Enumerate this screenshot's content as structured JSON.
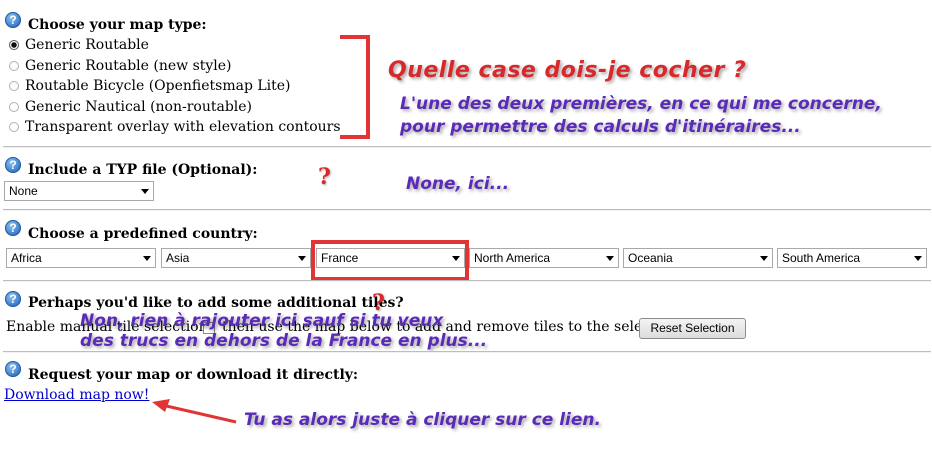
{
  "sections": {
    "map_type": {
      "heading": "Choose your map type:",
      "options": [
        {
          "label": "Generic Routable",
          "checked": true
        },
        {
          "label": "Generic Routable (new style)",
          "checked": false
        },
        {
          "label": "Routable Bicycle (Openfietsmap Lite)",
          "checked": false
        },
        {
          "label": "Generic Nautical (non-routable)",
          "checked": false
        },
        {
          "label": "Transparent overlay with elevation contours",
          "checked": false
        }
      ]
    },
    "typ_file": {
      "heading": "Include a TYP file (Optional):",
      "select_value": "None"
    },
    "country": {
      "heading": "Choose a predefined country:",
      "selects": [
        "Africa",
        "Asia",
        "France",
        "North America",
        "Oceania",
        "South America"
      ]
    },
    "tiles": {
      "heading": "Perhaps you'd like to add some additional tiles?",
      "text_before": "Enable manual tile selection:",
      "text_after": "then use the map below to add and remove tiles to the selection.",
      "reset_button": "Reset Selection"
    },
    "download": {
      "heading": "Request your map or download it directly:",
      "link": "Download map now!"
    }
  },
  "help_icon_glyph": "?",
  "annotations": {
    "title": "Quelle case dois-je cocher ?",
    "map_type_line1": "L'une des deux premières, en ce qui me concerne,",
    "map_type_line2": "pour permettre des calculs d'itinéraires...",
    "typ_qmark": "?",
    "typ_note": "None, ici...",
    "tiles_qmark": "?",
    "tiles_line1": "Non, rien à rajouter ici sauf si tu veux",
    "tiles_line2": "des trucs en dehors de la France en plus...",
    "download_note": "Tu as alors juste à cliquer sur ce lien."
  },
  "colors": {
    "annotation_red": "#d9282b",
    "annotation_purple": "#5a2ab8",
    "link_blue": "#0000cc"
  }
}
